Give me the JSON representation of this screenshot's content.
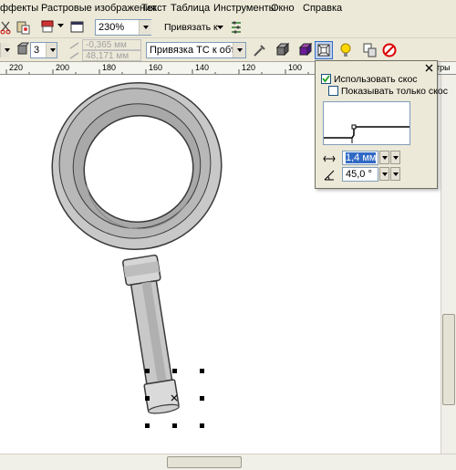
{
  "menu": {
    "items": [
      "ффекты",
      "Растровые изображения",
      "Текст",
      "Таблица",
      "Инструменты",
      "Окно",
      "Справка"
    ]
  },
  "toolbar": {
    "zoom_value": "230%",
    "snap_label": "Привязать к"
  },
  "propbar": {
    "count_value": "3",
    "x_value": "-0,365 мм",
    "y_value": "48,171 мм",
    "snap_select": "Привязка ТС к объекту"
  },
  "ruler": {
    "labels": [
      "220",
      "200",
      "180",
      "160",
      "140",
      "120",
      "100"
    ],
    "right_text": "тры"
  },
  "bevel": {
    "use_bevel_label": "Использовать скос",
    "use_bevel_checked": true,
    "show_only_bevel_label": "Показывать только скос",
    "show_only_bevel_checked": false,
    "width_value": "1,4 мм",
    "angle_value": "45,0 °"
  },
  "colors": {
    "chrome": "#ece9d8",
    "magnifier_fill": "#c8c8c8",
    "magnifier_stroke": "#3a3a3a",
    "highlight": "#316ac5"
  }
}
